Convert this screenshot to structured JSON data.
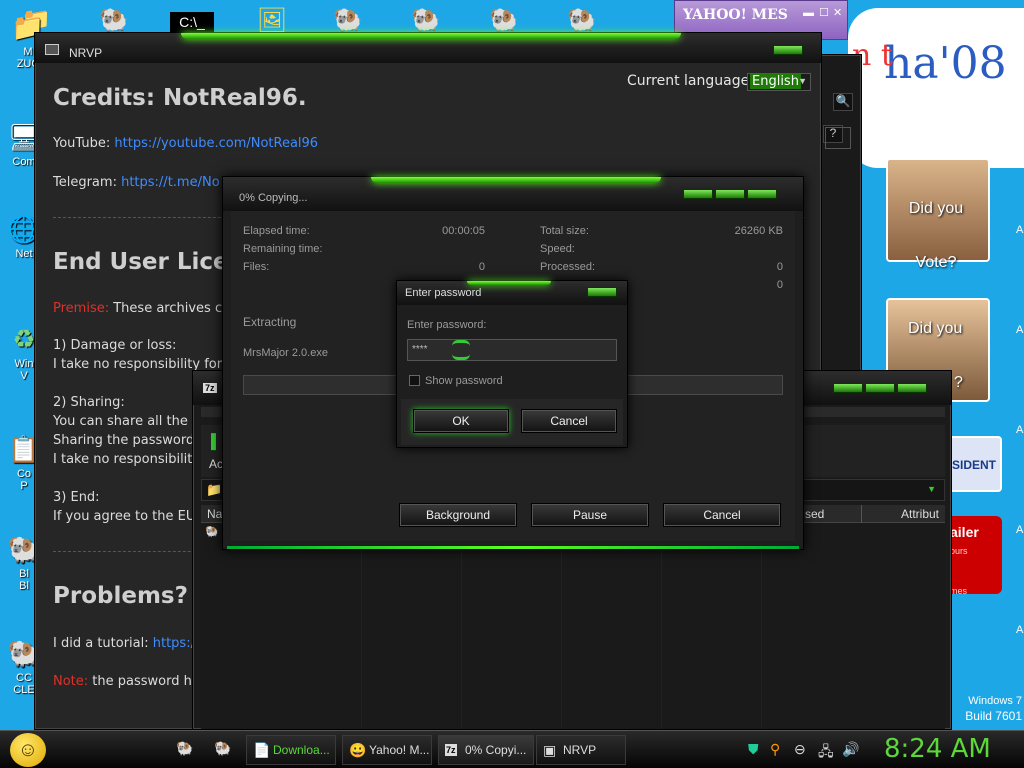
{
  "desktop": {
    "icons": [
      {
        "label": "M\nZUC",
        "glyph": "📁"
      },
      {
        "label": "Com",
        "glyph": "🖥"
      },
      {
        "label": "Net",
        "glyph": "🌐"
      },
      {
        "label": "Win\nV",
        "glyph": "♻"
      },
      {
        "label": "Co\nP",
        "glyph": "📋"
      },
      {
        "label": "Bl\nBl",
        "glyph": "🐏"
      },
      {
        "label": "CC\nCLE",
        "glyph": "🐏"
      }
    ],
    "watermark_line1": "Windows 7",
    "watermark_line2": "Build 7601"
  },
  "yahoo": {
    "title": "YAHOO! MES"
  },
  "gadget": {
    "banner_text": "ha'08",
    "tile1": "Did you Vote?",
    "tile2": "Did you",
    "tile2_extra": "?",
    "tile3": "SIDENT",
    "tile4": "ailer",
    "tile4_sub1": "ours",
    "tile4_sub2": "mes"
  },
  "nrvp": {
    "title": "NRVP",
    "language_label": "Current language:",
    "language_value": "English",
    "credits_heading": "Credits: NotReal96.",
    "youtube_label": "YouTube: ",
    "youtube_link": "https://youtube.com/NotReal96",
    "telegram_label": "Telegram: ",
    "telegram_link": "https://t.me/No",
    "eula_heading": "End User Licer",
    "premise_label": "Premise:",
    "premise_text": " These archives c",
    "s1_title": "1) Damage or loss:",
    "s1_text": "I take no responsibility for",
    "s2_title": "2) Sharing:",
    "s2_line1": "You can share all the",
    "s2_line2": "Sharing the password",
    "s2_line3": "I take no responsibilit",
    "s3_title": "3) End:",
    "s3_text": "If you agree to the EU",
    "problems_heading": "Problems?",
    "tutorial_text": "I did a tutorial: ",
    "tutorial_link": "https:/",
    "note_label": "Note:",
    "note_text": " the password h"
  },
  "fm": {
    "title": "7z",
    "toolbar_label": "Ac",
    "col_name": "Na",
    "col_used": "sed",
    "col_attr": "Attribut"
  },
  "copy": {
    "title": "0% Copying...",
    "elapsed_label": "Elapsed time:",
    "elapsed_value": "00:00:05",
    "remaining_label": "Remaining time:",
    "files_label": "Files:",
    "files_value": "0",
    "total_label": "Total size:",
    "total_value": "26260 KB",
    "speed_label": "Speed:",
    "processed_label": "Processed:",
    "processed_value": "0",
    "extra_value": "0",
    "extracting_label": "Extracting",
    "filename": "MrsMajor 2.0.exe",
    "btn_background": "Background",
    "btn_pause": "Pause",
    "btn_cancel": "Cancel",
    "progress": 0
  },
  "password": {
    "title": "Enter password",
    "label": "Enter password:",
    "value": "****",
    "show_label": "Show password",
    "ok": "OK",
    "cancel": "Cancel"
  },
  "taskbar": {
    "items": [
      {
        "label": "Downloa...",
        "icon": "📄"
      },
      {
        "label": "Yahoo! M...",
        "icon": "😀"
      },
      {
        "label": "0% Copyi...",
        "icon": "7z"
      },
      {
        "label": "NRVP",
        "icon": "▣"
      }
    ],
    "clock": "8:24 AM"
  },
  "colors": {
    "accent": "#5cd83a",
    "desktop": "#1ea7e6",
    "link": "#3f8cff"
  }
}
